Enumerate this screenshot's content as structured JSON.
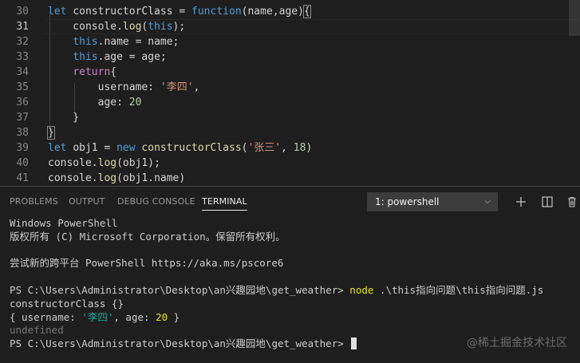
{
  "editor": {
    "current_line": 31,
    "lines": [
      {
        "n": "30",
        "tokens": [
          [
            "kw",
            "let "
          ],
          [
            "pl",
            "constructorClass = "
          ],
          [
            "kw",
            "function"
          ],
          [
            "pl",
            "(name,age){"
          ]
        ]
      },
      {
        "n": "31",
        "tokens": [
          [
            "pl",
            "    console."
          ],
          [
            "fn",
            "log"
          ],
          [
            "pl",
            "("
          ],
          [
            "kw",
            "this"
          ],
          [
            "pl",
            ");"
          ]
        ]
      },
      {
        "n": "32",
        "tokens": [
          [
            "pl",
            "    "
          ],
          [
            "kw",
            "this"
          ],
          [
            "pl",
            ".name = name;"
          ]
        ]
      },
      {
        "n": "33",
        "tokens": [
          [
            "pl",
            "    "
          ],
          [
            "kw",
            "this"
          ],
          [
            "pl",
            ".age = age;"
          ]
        ]
      },
      {
        "n": "34",
        "tokens": [
          [
            "pl",
            "    "
          ],
          [
            "ctl",
            "return"
          ],
          [
            "pl",
            "{"
          ]
        ]
      },
      {
        "n": "35",
        "tokens": [
          [
            "pl",
            "        username: "
          ],
          [
            "str",
            "'李四'"
          ],
          [
            "pl",
            ","
          ]
        ]
      },
      {
        "n": "36",
        "tokens": [
          [
            "pl",
            "        age: "
          ],
          [
            "num",
            "20"
          ]
        ]
      },
      {
        "n": "37",
        "tokens": [
          [
            "pl",
            "    }"
          ]
        ]
      },
      {
        "n": "38",
        "tokens": [
          [
            "pl",
            "}"
          ]
        ]
      },
      {
        "n": "39",
        "tokens": [
          [
            "kw",
            "let "
          ],
          [
            "pl",
            "obj1 = "
          ],
          [
            "kw",
            "new "
          ],
          [
            "fn",
            "constructorClass"
          ],
          [
            "pl",
            "("
          ],
          [
            "str",
            "'张三'"
          ],
          [
            "pl",
            ", "
          ],
          [
            "num",
            "18"
          ],
          [
            "pl",
            ")"
          ]
        ]
      },
      {
        "n": "40",
        "tokens": [
          [
            "pl",
            "console."
          ],
          [
            "fn",
            "log"
          ],
          [
            "pl",
            "(obj1);"
          ]
        ]
      },
      {
        "n": "41",
        "tokens": [
          [
            "pl",
            "console."
          ],
          [
            "fn",
            "log"
          ],
          [
            "pl",
            "(obj1.name)"
          ]
        ]
      }
    ]
  },
  "panel": {
    "tabs": [
      {
        "label": "PROBLEMS",
        "active": false
      },
      {
        "label": "OUTPUT",
        "active": false
      },
      {
        "label": "DEBUG CONSOLE",
        "active": false
      },
      {
        "label": "TERMINAL",
        "active": true
      }
    ],
    "terminal_select": "1: powershell",
    "actions": [
      "new-terminal-icon",
      "split-terminal-icon",
      "trash-icon"
    ]
  },
  "terminal": {
    "lines": [
      [
        [
          "",
          "Windows PowerShell"
        ]
      ],
      [
        [
          "",
          "版权所有 (C) Microsoft Corporation。保留所有权利。"
        ]
      ],
      [],
      [
        [
          "",
          "尝试新的跨平台 PowerShell https://aka.ms/pscore6"
        ]
      ],
      [],
      [
        [
          "",
          "PS C:\\Users\\Administrator\\Desktop\\an兴趣园地\\get_weather> "
        ],
        [
          "t-cmd",
          "node"
        ],
        [
          "",
          " .\\this指向问题\\this指向问题.js"
        ]
      ],
      [
        [
          "",
          "constructorClass {}"
        ]
      ],
      [
        [
          "",
          "{ username: "
        ],
        [
          "t-str",
          "'李四'"
        ],
        [
          "",
          ", age: "
        ],
        [
          "t-num",
          "20"
        ],
        [
          "",
          " }"
        ]
      ],
      [
        [
          "t-dim",
          "undefined"
        ]
      ],
      [
        [
          "",
          "PS C:\\Users\\Administrator\\Desktop\\an兴趣园地\\get_weather> "
        ]
      ]
    ]
  },
  "watermark": "@稀土掘金技术社区",
  "colors": {
    "background": "#1e1e1e",
    "keyword": "#569cd6",
    "string": "#ce9178",
    "number": "#b5cea8",
    "function": "#dcdcaa",
    "control": "#c586c0"
  }
}
